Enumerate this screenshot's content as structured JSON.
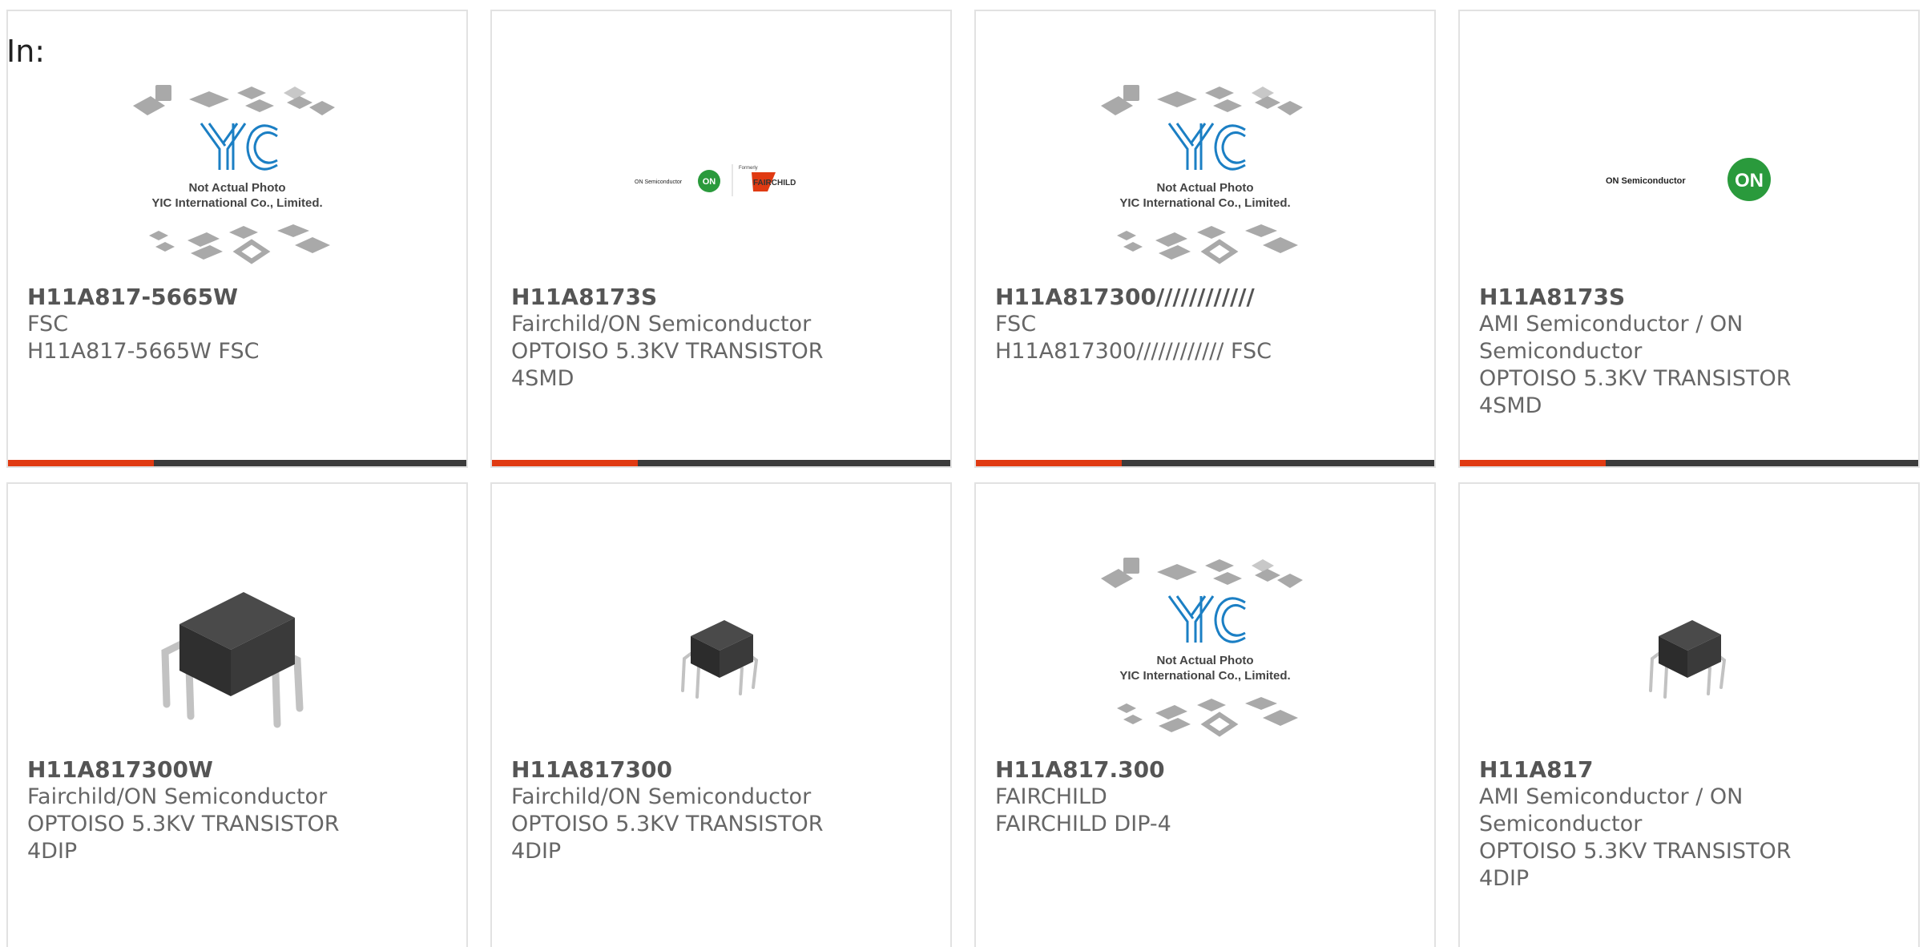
{
  "header": {
    "in_label": "In:"
  },
  "yic_caption": {
    "line1": "Not Actual Photo",
    "line2": "YIC International Co., Limited.",
    "logo": "YIC"
  },
  "on_logo": {
    "text": "ON Semiconductor",
    "badge": "ON",
    "formerly": "Formerly",
    "fairchild": "FAIRCHILD"
  },
  "colors": {
    "accent": "#e03a12",
    "bar": "#3b3b3b",
    "text": "#666666",
    "yic_blue": "#1b7fc4",
    "on_green": "#2a9a3c"
  },
  "products": [
    {
      "image": "yic-placeholder",
      "part": "H11A817-5665W",
      "manufacturer": "FSC",
      "lines": [
        "H11A817-5665W FSC"
      ]
    },
    {
      "image": "on-fairchild-logo",
      "part": "H11A8173S",
      "manufacturer": "Fairchild/ON Semiconductor",
      "lines": [
        "OPTOISO 5.3KV TRANSISTOR",
        "4SMD"
      ]
    },
    {
      "image": "yic-placeholder",
      "part": "H11A817300////////////",
      "manufacturer": "FSC",
      "lines": [
        "H11A817300//////////// FSC"
      ]
    },
    {
      "image": "on-logo",
      "part": "H11A8173S",
      "manufacturer": "AMI Semiconductor / ON",
      "lines": [
        "Semiconductor",
        "OPTOISO 5.3KV TRANSISTOR",
        "4SMD"
      ]
    },
    {
      "image": "dip4-large",
      "part": "H11A817300W",
      "manufacturer": "Fairchild/ON Semiconductor",
      "lines": [
        "OPTOISO 5.3KV TRANSISTOR",
        "4DIP"
      ]
    },
    {
      "image": "dip4-small",
      "part": "H11A817300",
      "manufacturer": "Fairchild/ON Semiconductor",
      "lines": [
        "OPTOISO 5.3KV TRANSISTOR",
        "4DIP"
      ]
    },
    {
      "image": "yic-placeholder",
      "part": "H11A817.300",
      "manufacturer": "FAIRCHILD",
      "lines": [
        "FAIRCHILD DIP-4"
      ]
    },
    {
      "image": "dip4-small",
      "part": "H11A817",
      "manufacturer": "AMI Semiconductor / ON",
      "lines": [
        "Semiconductor",
        "OPTOISO 5.3KV TRANSISTOR",
        "4DIP"
      ]
    }
  ]
}
